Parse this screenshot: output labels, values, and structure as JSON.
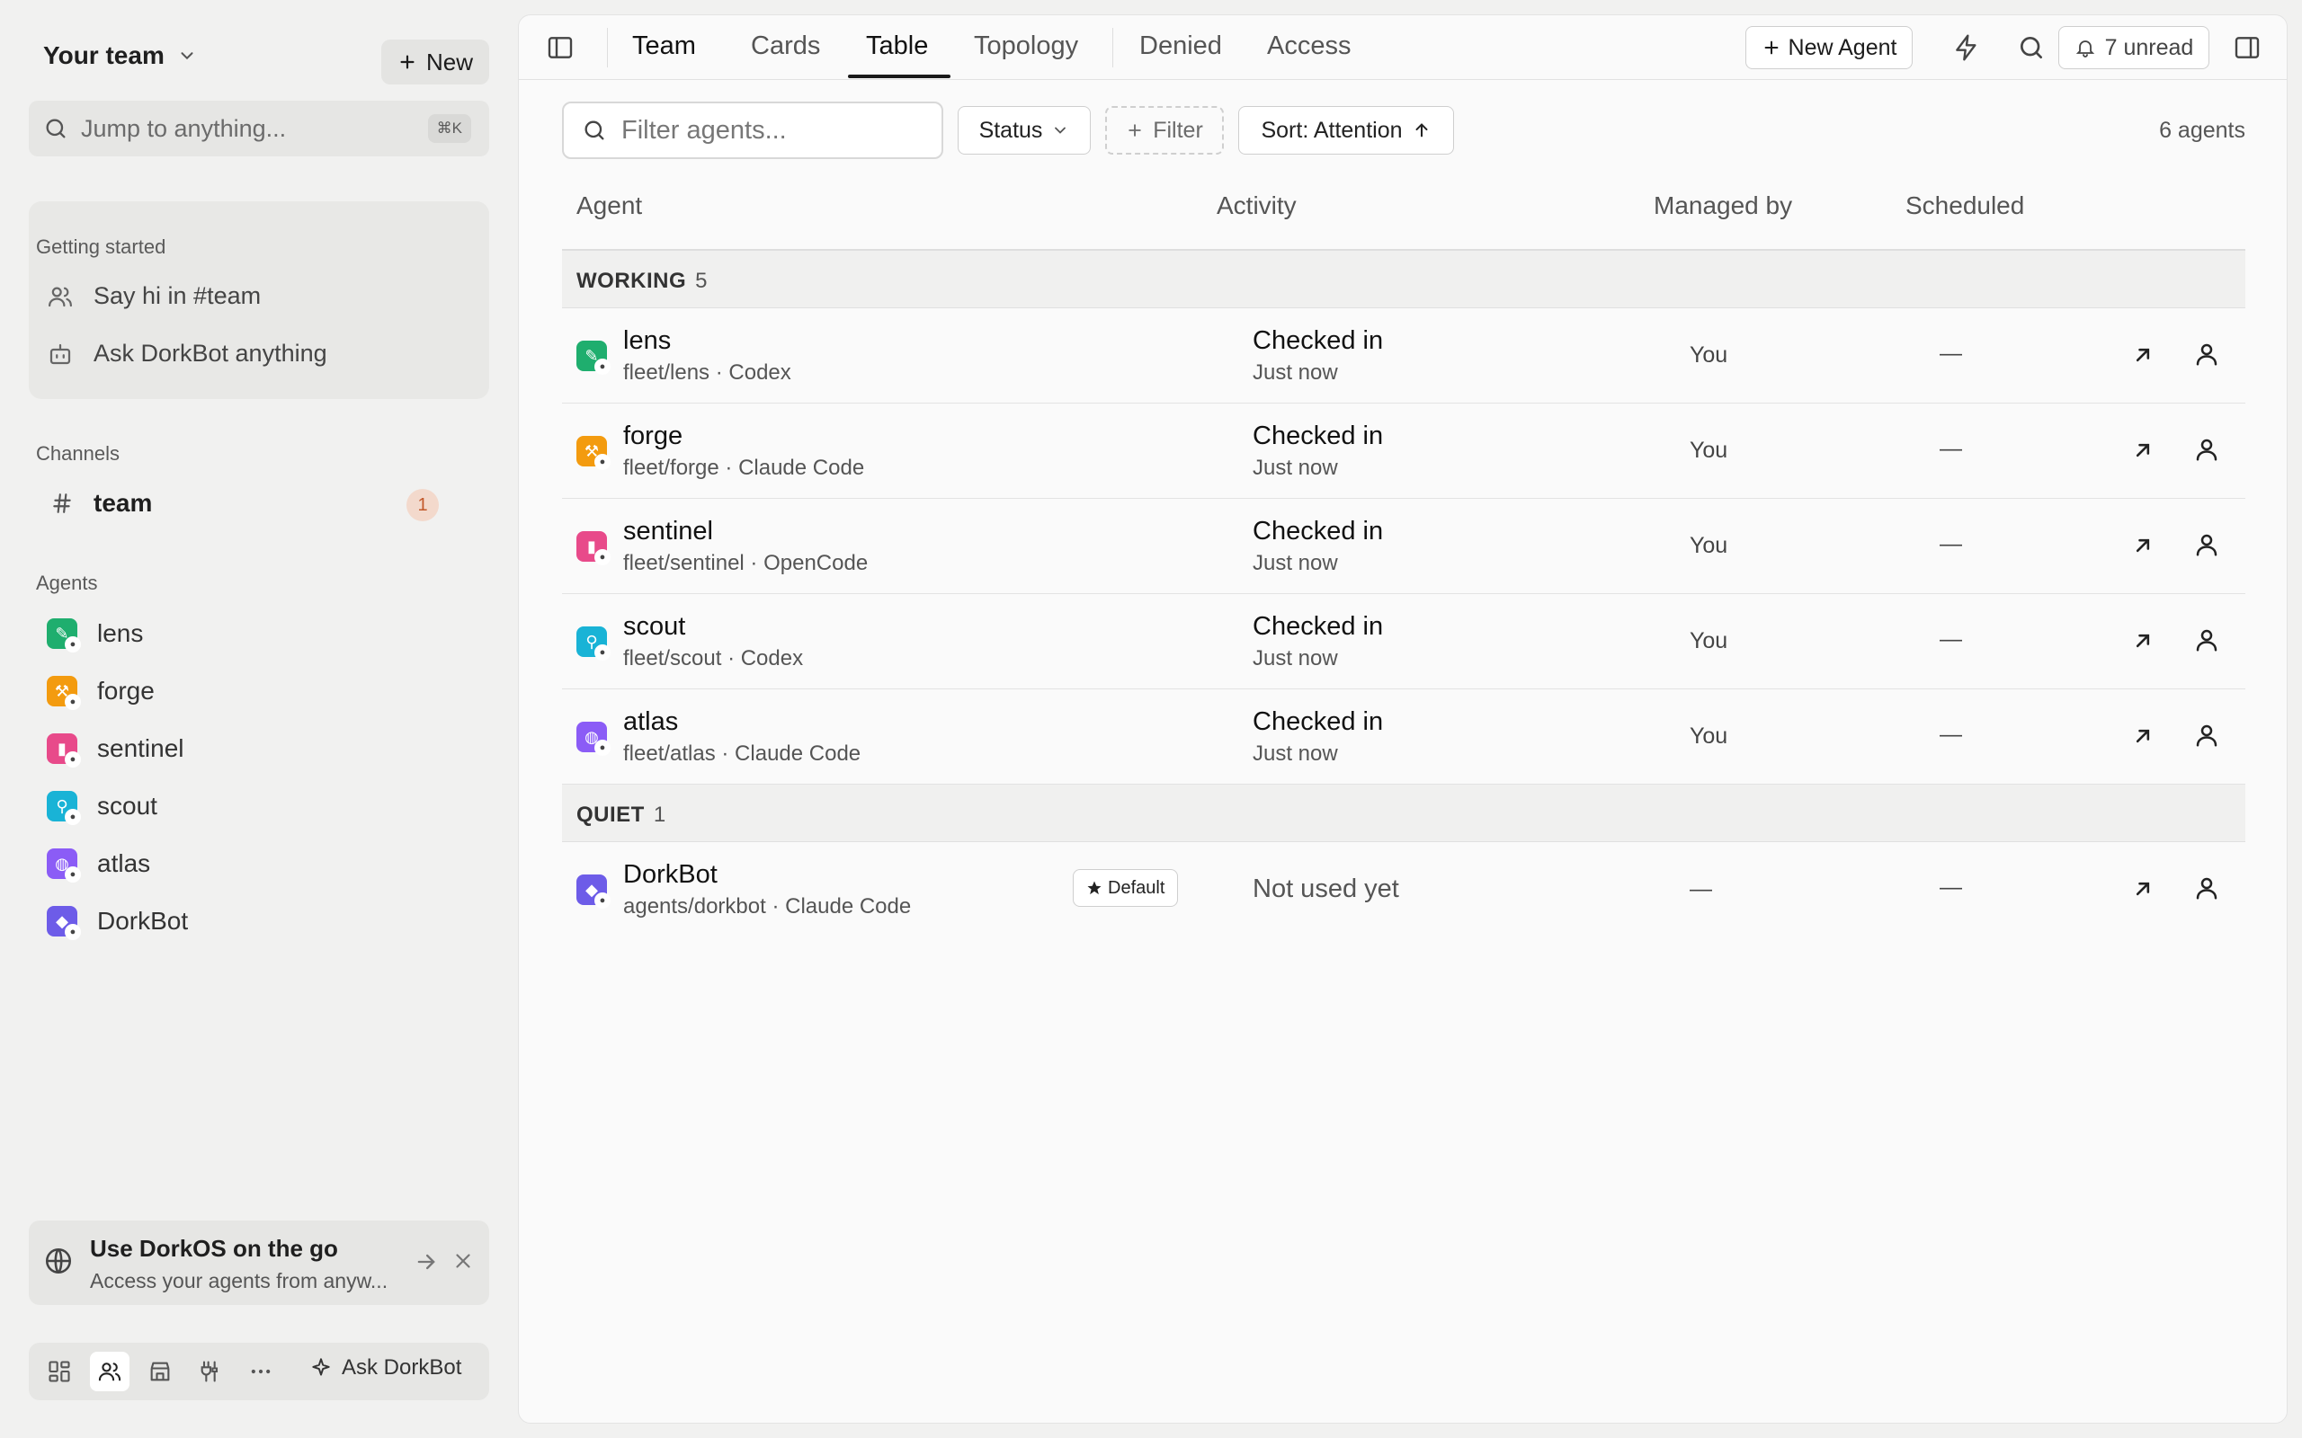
{
  "sidebar": {
    "team_name": "Your team",
    "new_label": "New",
    "jump_placeholder": "Jump to anything...",
    "jump_shortcut": "⌘K",
    "getting_started": {
      "title": "Getting started",
      "items": [
        {
          "label": "Say hi in #team",
          "icon": "users-icon"
        },
        {
          "label": "Ask DorkBot anything",
          "icon": "bot-icon"
        }
      ]
    },
    "channels": {
      "title": "Channels",
      "items": [
        {
          "label": "team",
          "badge": "1"
        }
      ]
    },
    "agents": {
      "title": "Agents",
      "items": [
        {
          "label": "lens",
          "color": "#1fae6e"
        },
        {
          "label": "forge",
          "color": "#f39b0f"
        },
        {
          "label": "sentinel",
          "color": "#e84a8a"
        },
        {
          "label": "scout",
          "color": "#19b3d6"
        },
        {
          "label": "atlas",
          "color": "#8b5cf6"
        },
        {
          "label": "DorkBot",
          "color": "#6d5ce8"
        }
      ]
    },
    "promo": {
      "title": "Use DorkOS on the go",
      "subtitle": "Access your agents from anyw..."
    },
    "bottom": {
      "ask_label": "Ask DorkBot"
    }
  },
  "topbar": {
    "tabs": [
      "Team",
      "Cards",
      "Table",
      "Topology",
      "Denied",
      "Access"
    ],
    "active_tab": "Table",
    "new_agent_label": "New Agent",
    "unread_label": "7 unread"
  },
  "filters": {
    "search_placeholder": "Filter agents...",
    "status_label": "Status",
    "filter_label": "Filter",
    "sort_label": "Sort: Attention",
    "count_label": "6 agents"
  },
  "table": {
    "headers": [
      "Agent",
      "Activity",
      "Managed by",
      "Scheduled"
    ],
    "groups": [
      {
        "name": "WORKING",
        "count": "5",
        "rows": [
          {
            "name": "lens",
            "path": "fleet/lens · Codex",
            "activity": "Checked in",
            "activity_time": "Just now",
            "managed": "You",
            "scheduled": "—",
            "color": "#1fae6e"
          },
          {
            "name": "forge",
            "path": "fleet/forge · Claude Code",
            "activity": "Checked in",
            "activity_time": "Just now",
            "managed": "You",
            "scheduled": "—",
            "color": "#f39b0f"
          },
          {
            "name": "sentinel",
            "path": "fleet/sentinel · OpenCode",
            "activity": "Checked in",
            "activity_time": "Just now",
            "managed": "You",
            "scheduled": "—",
            "color": "#e84a8a"
          },
          {
            "name": "scout",
            "path": "fleet/scout · Codex",
            "activity": "Checked in",
            "activity_time": "Just now",
            "managed": "You",
            "scheduled": "—",
            "color": "#19b3d6"
          },
          {
            "name": "atlas",
            "path": "fleet/atlas · Claude Code",
            "activity": "Checked in",
            "activity_time": "Just now",
            "managed": "You",
            "scheduled": "—",
            "color": "#8b5cf6"
          }
        ]
      },
      {
        "name": "QUIET",
        "count": "1",
        "rows": [
          {
            "name": "DorkBot",
            "path": "agents/dorkbot · Claude Code",
            "badge": "Default",
            "activity": "Not used yet",
            "managed": "—",
            "scheduled": "—",
            "color": "#6d5ce8"
          }
        ]
      }
    ]
  }
}
